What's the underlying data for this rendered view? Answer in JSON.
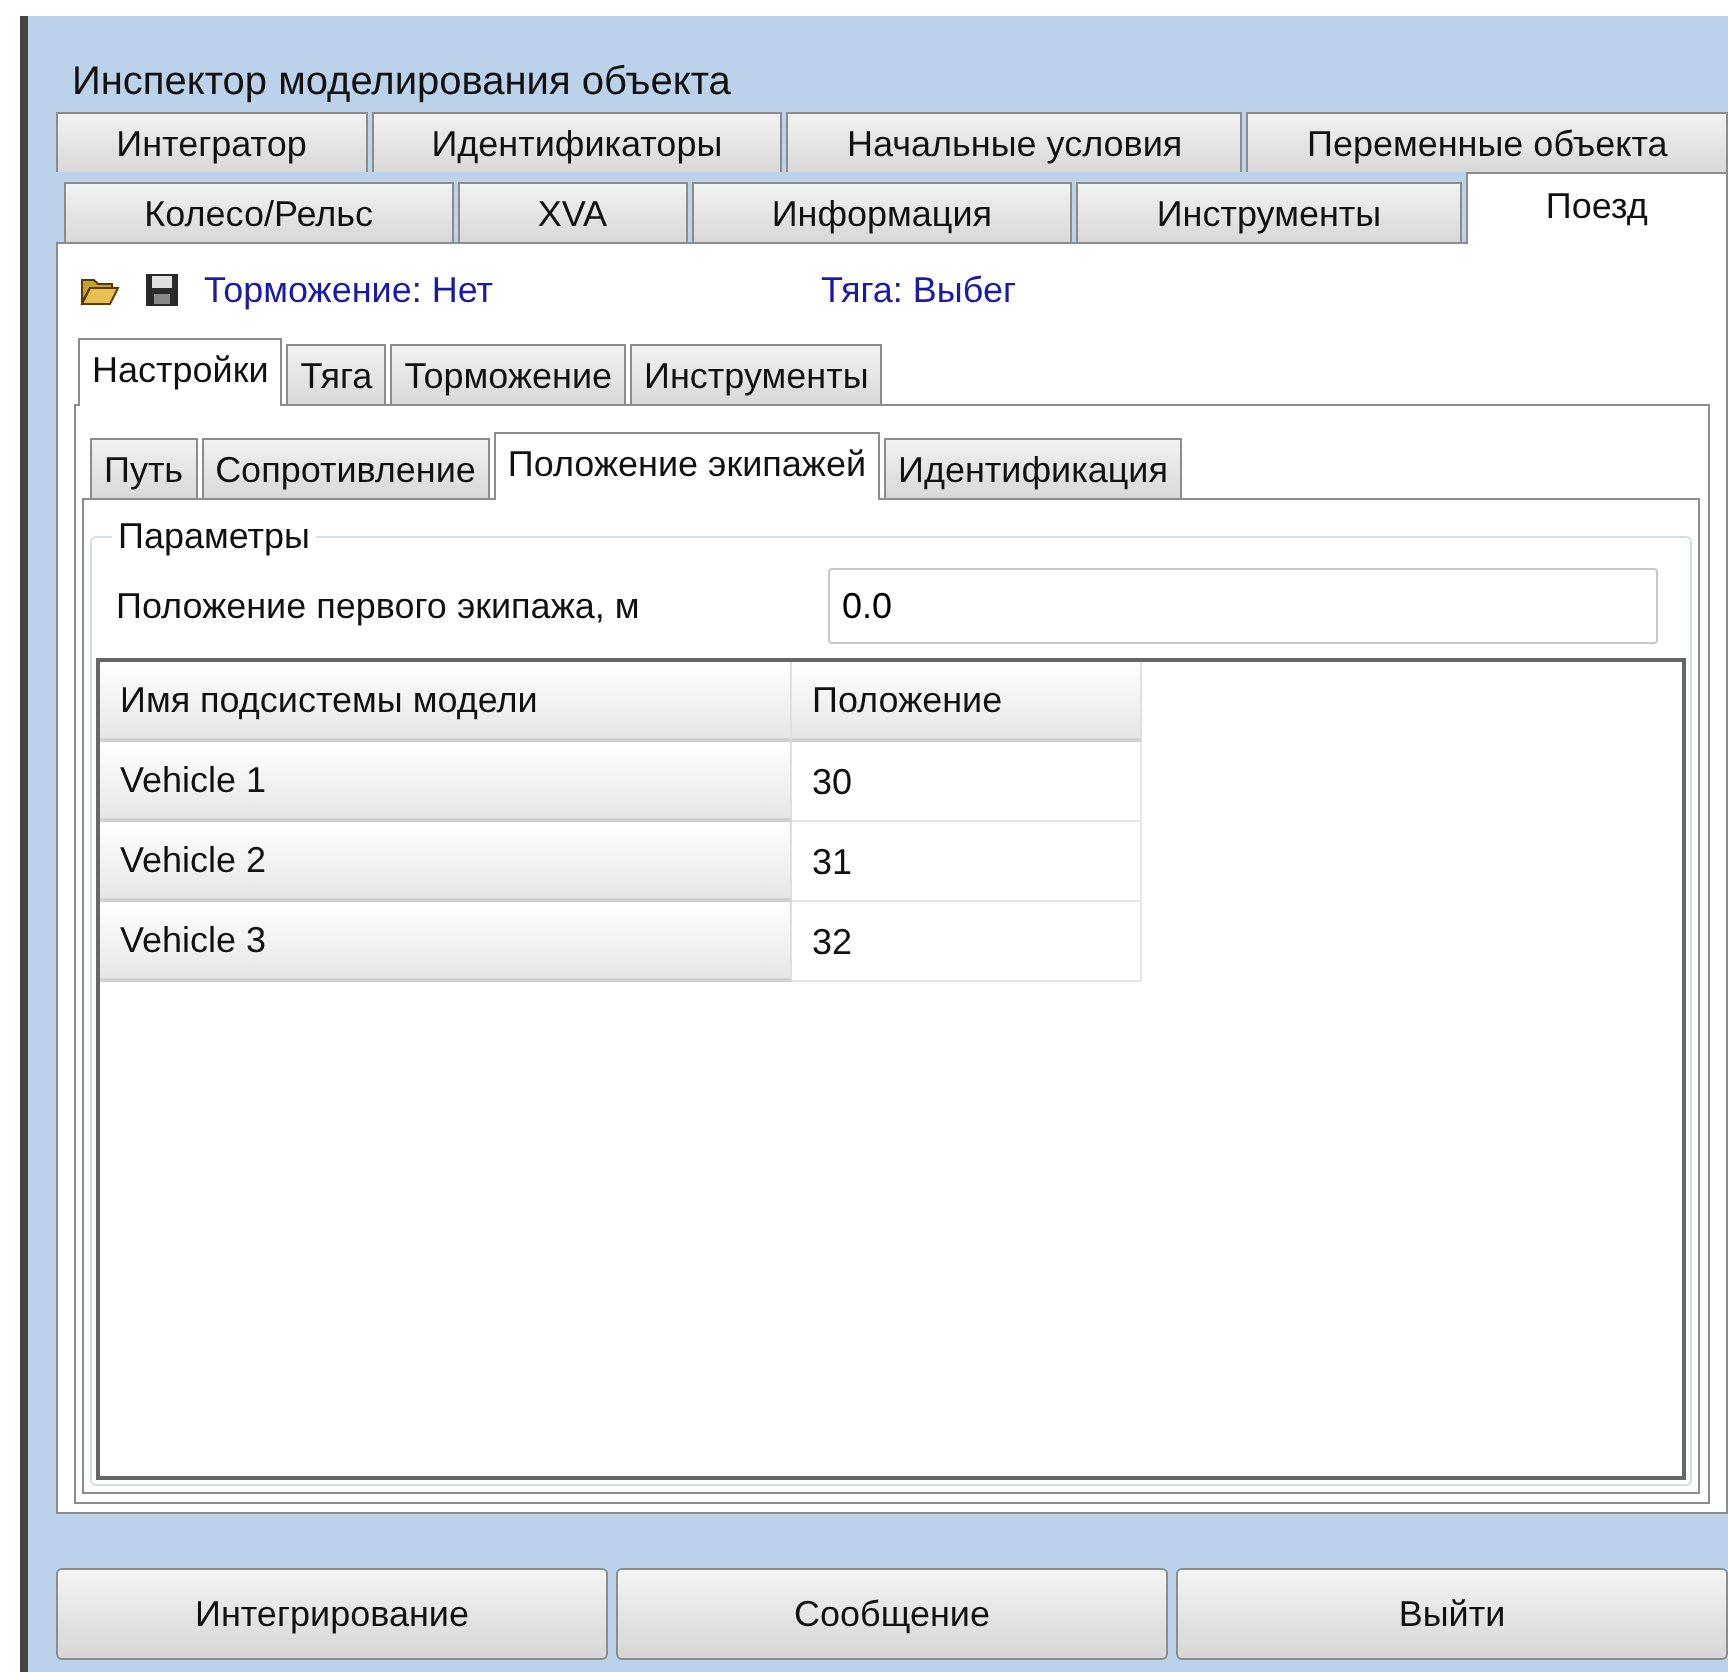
{
  "window": {
    "title": "Инспектор моделирования объекта"
  },
  "tab_rows": [
    {
      "tabs": [
        {
          "label": "Интегратор",
          "selected": false
        },
        {
          "label": "Идентификаторы",
          "selected": false
        },
        {
          "label": "Начальные условия",
          "selected": false
        },
        {
          "label": "Переменные объекта",
          "selected": false
        }
      ]
    },
    {
      "tabs": [
        {
          "label": "Колесо/Рельс",
          "selected": false
        },
        {
          "label": "XVA",
          "selected": false
        },
        {
          "label": "Информация",
          "selected": false
        },
        {
          "label": "Инструменты",
          "selected": false
        },
        {
          "label": "Поезд",
          "selected": true
        }
      ]
    }
  ],
  "status": [
    {
      "text": "Торможение: Нет"
    },
    {
      "text": "Тяга: Выбег"
    }
  ],
  "sub_tabs": [
    {
      "label": "Настройки",
      "selected": true
    },
    {
      "label": "Тяга",
      "selected": false
    },
    {
      "label": "Торможение",
      "selected": false
    },
    {
      "label": "Инструменты",
      "selected": false
    }
  ],
  "page_tabs": [
    {
      "label": "Путь",
      "selected": false
    },
    {
      "label": "Сопротивление",
      "selected": false
    },
    {
      "label": "Положение экипажей",
      "selected": true
    },
    {
      "label": "Идентификация",
      "selected": false
    }
  ],
  "group": {
    "title": "Параметры",
    "field": {
      "label": "Положение первого экипажа, м",
      "value": "0.0"
    }
  },
  "table": {
    "columns": [
      "Имя подсистемы модели",
      "Положение"
    ],
    "rows": [
      {
        "cells": [
          "Vehicle 1",
          "30"
        ]
      },
      {
        "cells": [
          "Vehicle 2",
          "31"
        ]
      },
      {
        "cells": [
          "Vehicle 3",
          "32"
        ]
      }
    ]
  },
  "buttons": [
    "Интегрирование",
    "Сообщение",
    "Выйти"
  ]
}
